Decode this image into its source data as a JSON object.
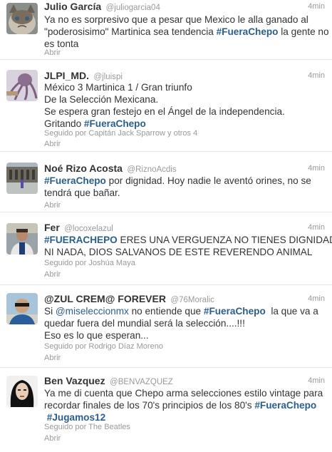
{
  "colors": {
    "link": "#2a5e8c",
    "muted": "#999999",
    "text": "#333333",
    "divider": "#e6e6e6"
  },
  "tweets": [
    {
      "fullname": "Julio García",
      "username": "@juliogarcia04",
      "time": "4min",
      "avatar_icon": "grumpy-cat-avatar",
      "lines": [
        [
          {
            "t": "Ya no es sorpresivo que a pesar que Mexico le alla ganado al"
          }
        ],
        [
          {
            "t": "\"poderosisimo\" Martinica sea tendencia "
          },
          {
            "t": "#FueraChepo",
            "k": "hashtag"
          },
          {
            "t": " la gente no"
          }
        ],
        [
          {
            "t": "es tonta"
          }
        ]
      ],
      "retweeted_by": "",
      "expand": "Abrir"
    },
    {
      "fullname": "JLPI_MD.",
      "username": "@jluispi",
      "time": "4min",
      "avatar_icon": "octopus-avatar",
      "lines": [
        [
          {
            "t": "México 3 Martinica 1 / Gran triunfo"
          }
        ],
        [
          {
            "t": "De la Selección Mexicana."
          }
        ],
        [
          {
            "t": "Se espera gran festejo en el Ángel de la independencia."
          }
        ],
        [
          {
            "t": "Gritando "
          },
          {
            "t": "#FueraChepo",
            "k": "hashtag"
          }
        ]
      ],
      "retweeted_by": "Seguido por Capitán Jack Sparrow y otros 4",
      "expand": "Abrir"
    },
    {
      "fullname": "Noé Rizo Acosta",
      "username": "@RiznoAcdis",
      "time": "4min",
      "avatar_icon": "building-photo-avatar",
      "lines": [
        [
          {
            "t": "#FueraChepo",
            "k": "hashtag"
          },
          {
            "t": " por dignidad. Hoy nadie le aventó orines, no se"
          }
        ],
        [
          {
            "t": "tendrá que bañar."
          }
        ]
      ],
      "retweeted_by": "",
      "expand": "Abrir"
    },
    {
      "fullname": "Fer",
      "username": "@locoxelazul",
      "time": "4min",
      "avatar_icon": "person-avatar",
      "lines": [
        [
          {
            "t": "#FUERACHEPO",
            "k": "hashtag"
          },
          {
            "t": " ERES UNA VERGUENZA NO TIENES DIGNIDAD"
          }
        ],
        [
          {
            "t": "NI NADA, DIOS SALVANOS DE ESTE REVERENDO ANIMAL"
          }
        ]
      ],
      "retweeted_by": "Seguido por Joshúa Maya",
      "expand": "Abrir"
    },
    {
      "fullname": "@ZUL CREM@ FOREVER",
      "username": "@76Moralic",
      "time": "4min",
      "avatar_icon": "man-sunglasses-avatar",
      "lines": [
        [
          {
            "t": "Si "
          },
          {
            "t": "@miseleccionmx",
            "k": "mention"
          },
          {
            "t": " no entiende que "
          },
          {
            "t": "#FueraChepo",
            "k": "hashtag"
          },
          {
            "t": "  la que va a"
          }
        ],
        [
          {
            "t": "quedar fuera del mundial será la selección....!!!"
          }
        ],
        [
          {
            "t": "Eso es lo que esperan..."
          }
        ]
      ],
      "retweeted_by": "Seguido por Rodrigo Díaz Moreno",
      "expand": "Abrir"
    },
    {
      "fullname": "Ben Vazquez",
      "username": "@BENVAZQUEZ",
      "time": "4min",
      "avatar_icon": "face-portrait-avatar",
      "lines": [
        [
          {
            "t": "Ya me di cuenta que Chepo arma selecciones estilo vintage para"
          }
        ],
        [
          {
            "t": "recordar finales de los 70's principios de los 80's "
          },
          {
            "t": "#FueraChepo",
            "k": "hashtag"
          }
        ],
        [
          {
            "t": " "
          },
          {
            "t": "#Jugamos12",
            "k": "hashtag"
          }
        ]
      ],
      "retweeted_by": "Seguido por The Beatles",
      "expand": "Abrir"
    }
  ]
}
